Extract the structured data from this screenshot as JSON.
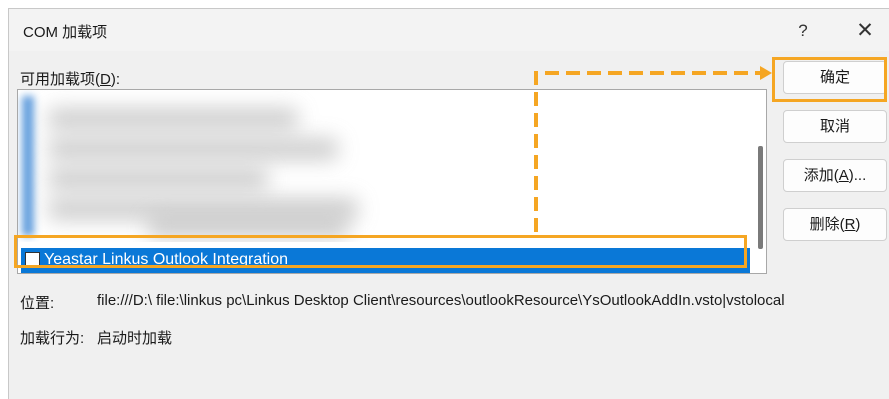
{
  "window": {
    "title": "COM 加载项",
    "help": "?",
    "close": "✕"
  },
  "addins": {
    "label_prefix": "可用加载项(",
    "label_key": "D",
    "label_suffix": "):",
    "selected_item": "Yeastar Linkus Outlook Integration",
    "selected_checked": false
  },
  "buttons": {
    "ok": "确定",
    "cancel": "取消",
    "add_prefix": "添加(",
    "add_key": "A",
    "add_suffix": ")...",
    "remove_prefix": "删除(",
    "remove_key": "R",
    "remove_suffix": ")"
  },
  "details": {
    "location_label": "位置:",
    "location_value": "file:///D:\\ file:\\linkus pc\\Linkus Desktop Client\\resources\\outlookResource\\YsOutlookAddIn.vsto|vstolocal",
    "load_behavior_label": "加载行为:",
    "load_behavior_value": "启动时加载"
  },
  "colors": {
    "highlight": "#f5a623",
    "selection": "#0a78d7"
  }
}
